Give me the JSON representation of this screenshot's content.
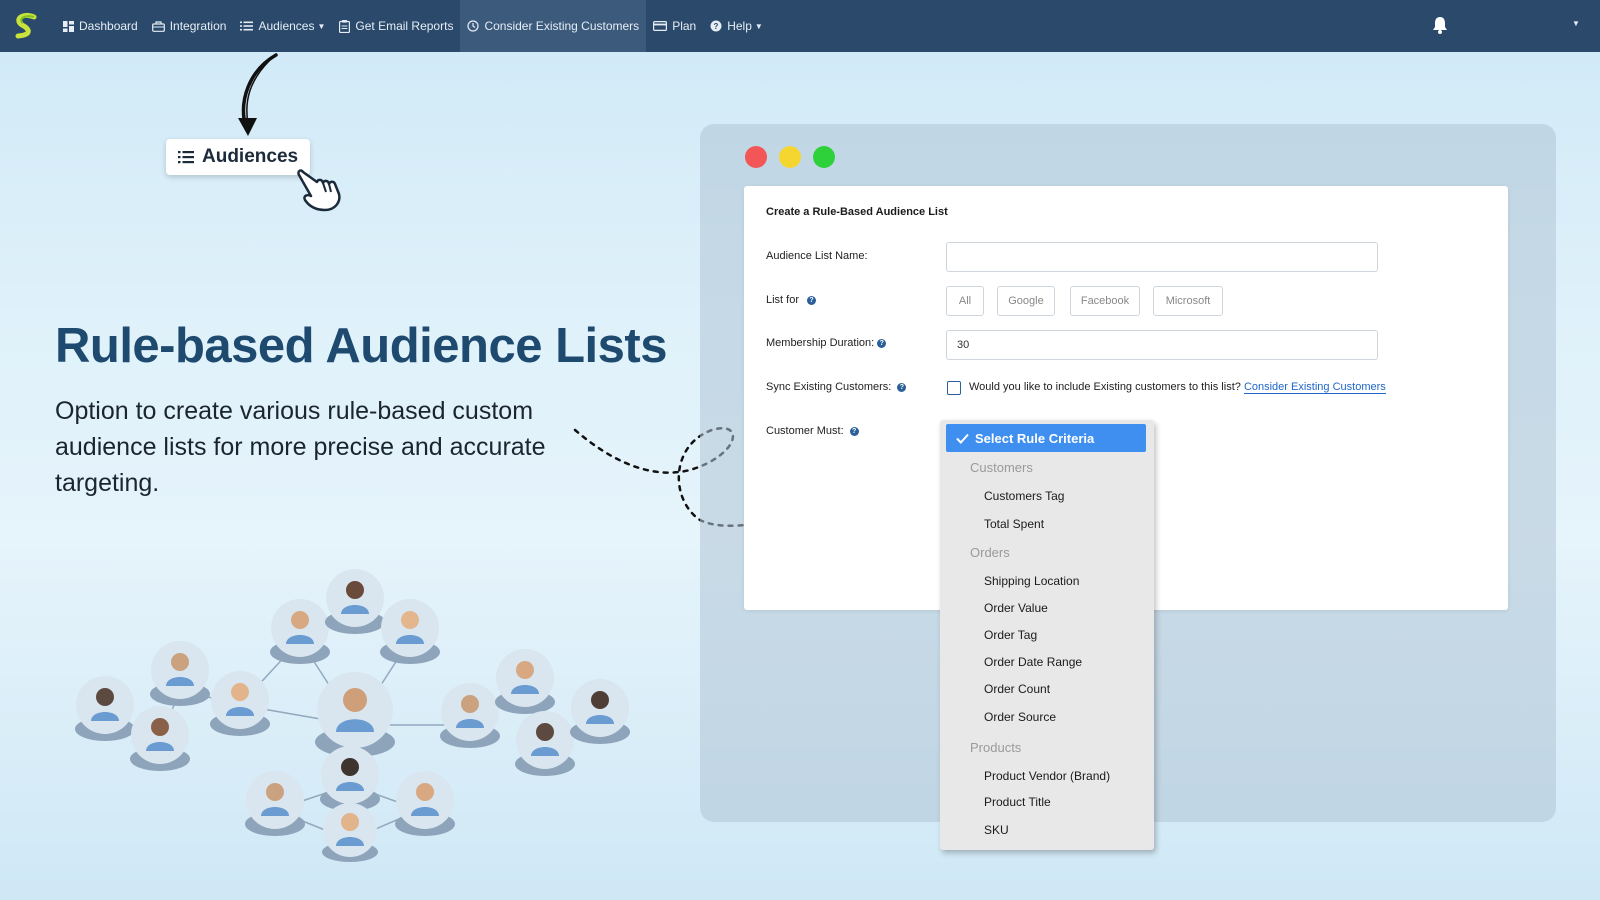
{
  "navbar": {
    "items": [
      {
        "label": "Dashboard",
        "icon": "dashboard-icon"
      },
      {
        "label": "Integration",
        "icon": "integration-icon"
      },
      {
        "label": "Audiences",
        "icon": "list-icon",
        "has_caret": true
      },
      {
        "label": "Get Email Reports",
        "icon": "clipboard-icon"
      },
      {
        "label": "Consider Existing Customers",
        "icon": "history-icon",
        "active": true
      },
      {
        "label": "Plan",
        "icon": "card-icon"
      },
      {
        "label": "Help",
        "icon": "help-circle-icon",
        "has_caret": true
      }
    ],
    "bg_color": "#2b4a6b"
  },
  "callout": {
    "label": "Audiences"
  },
  "hero": {
    "title": "Rule-based Audience Lists",
    "description": "Option to create various rule-based custom audience lists for more precise and accurate targeting."
  },
  "form": {
    "title": "Create a Rule-Based Audience List",
    "audience_list_name_label": "Audience List Name:",
    "audience_list_name_value": "",
    "list_for_label": "List for",
    "list_for_options": [
      "All",
      "Google",
      "Facebook",
      "Microsoft"
    ],
    "membership_duration_label": "Membership Duration:",
    "membership_duration_value": "30",
    "sync_label": "Sync Existing Customers:",
    "sync_question": "Would you like to include Existing customers to this list?",
    "sync_link": "Consider Existing Customers",
    "customer_must_label": "Customer Must:"
  },
  "dropdown": {
    "selected": "Select Rule Criteria",
    "groups": [
      {
        "label": "Customers",
        "options": [
          "Customers Tag",
          "Total Spent"
        ]
      },
      {
        "label": "Orders",
        "options": [
          "Shipping Location",
          "Order Value",
          "Order Tag",
          "Order Date Range",
          "Order Count",
          "Order Source"
        ]
      },
      {
        "label": "Products",
        "options": [
          "Product Vendor (Brand)",
          "Product Title",
          "SKU"
        ]
      }
    ],
    "selected_color": "#3f8ff0"
  },
  "colors": {
    "title": "#1f4a70",
    "window_red": "#f25656",
    "window_yellow": "#f5d631",
    "window_green": "#2fd13b",
    "link": "#1e66c8"
  }
}
